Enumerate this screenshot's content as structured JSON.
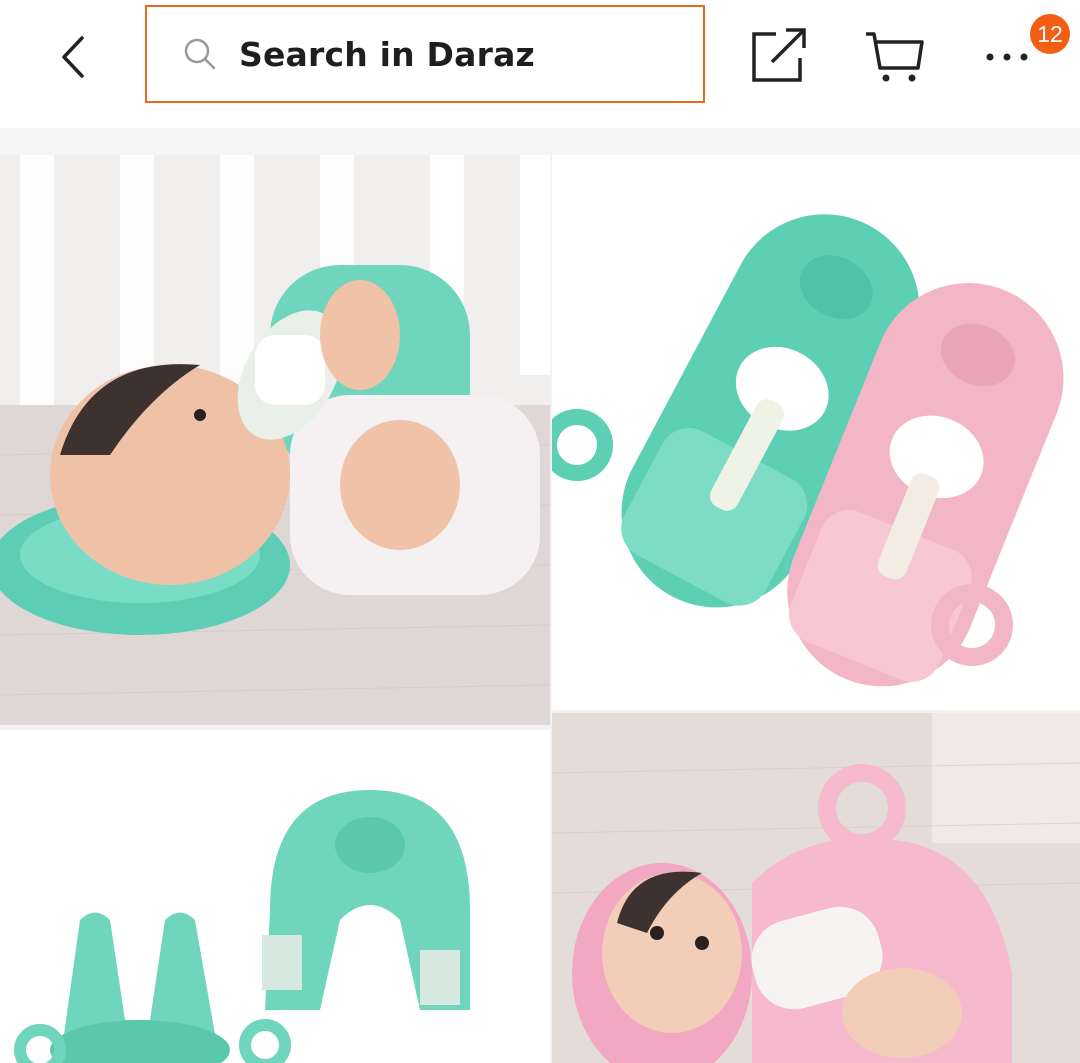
{
  "header": {
    "search_placeholder": "Search in Daraz",
    "cart_badge_count": "12",
    "icons": {
      "back": "chevron-left-icon",
      "search": "search-icon",
      "share": "share-icon",
      "cart": "cart-icon",
      "more": "more-dots-icon"
    }
  },
  "gallery": {
    "images": [
      "baby-feeding-pillow-teal-with-baby",
      "teal-and-pink-feeding-pillows-with-bottles",
      "teal-pillow-parts",
      "baby-with-pink-feeding-pillow"
    ]
  },
  "colors": {
    "accent": "#f25f14",
    "search_border": "#e86a1f",
    "teal_pillow": "#6ed6be",
    "pink_pillow": "#f3b6c6"
  }
}
